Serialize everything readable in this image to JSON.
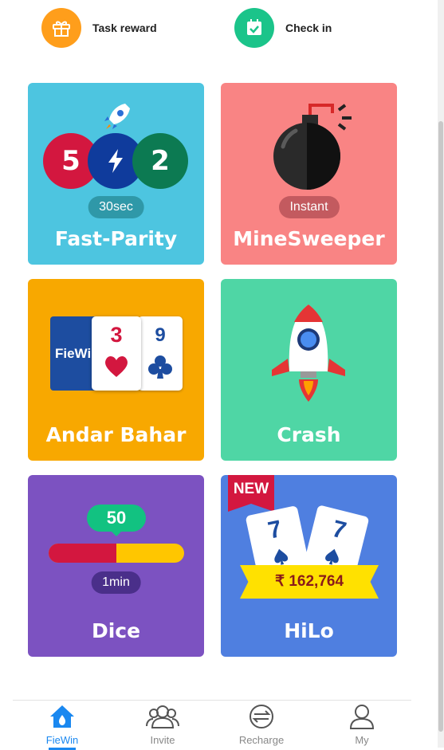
{
  "top_actions": [
    {
      "label": "Task reward",
      "icon": "gift-icon",
      "color": "#ff9e1b"
    },
    {
      "label": "Check in",
      "icon": "calendar-check-icon",
      "color": "#1bc48a"
    }
  ],
  "games": {
    "fast_parity": {
      "title": "Fast-Parity",
      "badge": "30sec",
      "balls": [
        "5",
        "2"
      ],
      "color": "#4dc5e0"
    },
    "minesweeper": {
      "title": "MineSweeper",
      "badge": "Instant",
      "color": "#f98484"
    },
    "andar_bahar": {
      "title": "Andar Bahar",
      "logo_text": "FieWin",
      "card1": "3",
      "card2": "9",
      "color": "#f8a800"
    },
    "crash": {
      "title": "Crash",
      "color": "#4fd6a5"
    },
    "dice": {
      "title": "Dice",
      "value": "50",
      "badge": "1min",
      "red_fraction": 0.5,
      "color": "#7c52c1"
    },
    "hilo": {
      "title": "HiLo",
      "new_label": "NEW",
      "card_value": "7",
      "amount": "₹ 162,764",
      "color": "#4f7fe0"
    }
  },
  "tabs": [
    {
      "label": "FieWin",
      "icon": "home-icon",
      "active": true
    },
    {
      "label": "Invite",
      "icon": "people-icon",
      "active": false
    },
    {
      "label": "Recharge",
      "icon": "exchange-icon",
      "active": false
    },
    {
      "label": "My",
      "icon": "user-icon",
      "active": false
    }
  ]
}
